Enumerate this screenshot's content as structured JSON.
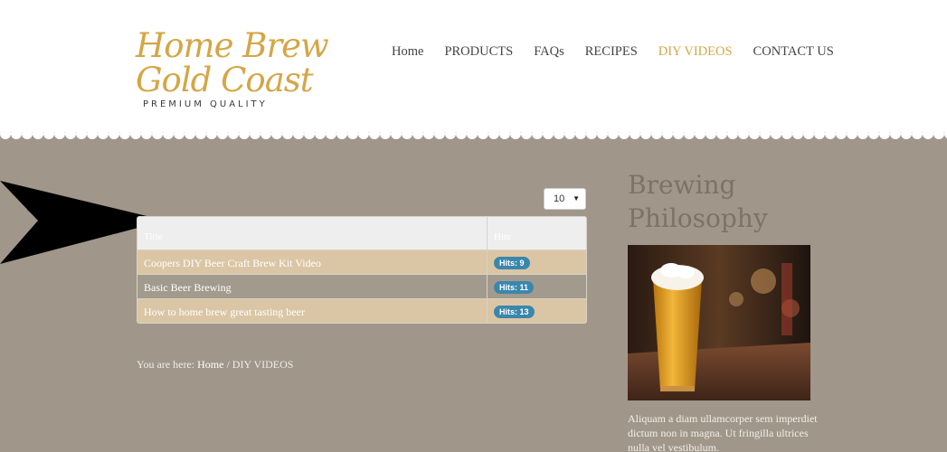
{
  "logo": {
    "line1": "Home Brew",
    "line2": "Gold Coast",
    "tagline": "PREMIUM QUALITY"
  },
  "nav": {
    "items": [
      {
        "label": "Home",
        "active": false
      },
      {
        "label": "PRODUCTS",
        "active": false
      },
      {
        "label": "FAQs",
        "active": false
      },
      {
        "label": "RECIPES",
        "active": false
      },
      {
        "label": "DIY VIDEOS",
        "active": true
      },
      {
        "label": "CONTACT US",
        "active": false
      }
    ]
  },
  "list": {
    "limit_value": "10",
    "columns": {
      "title": "Title",
      "hits": "Hits"
    },
    "rows": [
      {
        "title": "Coopers DIY Beer Craft Brew Kit Video",
        "hits": "Hits: 9"
      },
      {
        "title": "Basic Beer Brewing",
        "hits": "Hits: 11"
      },
      {
        "title": "How to home brew great tasting beer",
        "hits": "Hits: 13"
      }
    ]
  },
  "breadcrumb": {
    "prefix": "You are here: ",
    "home": "Home",
    "separator": " / ",
    "current": "DIY VIDEOS"
  },
  "sidebar": {
    "title": "Brewing Philosophy",
    "text": "Aliquam a diam ullamcorper sem imperdiet dictum non in magna. Ut fringilla ultrices nulla vel vestibulum."
  },
  "colors": {
    "accent": "#d4a647",
    "background": "#a0968a",
    "badge": "#3a87ad",
    "row_odd": "#dac6a5"
  }
}
